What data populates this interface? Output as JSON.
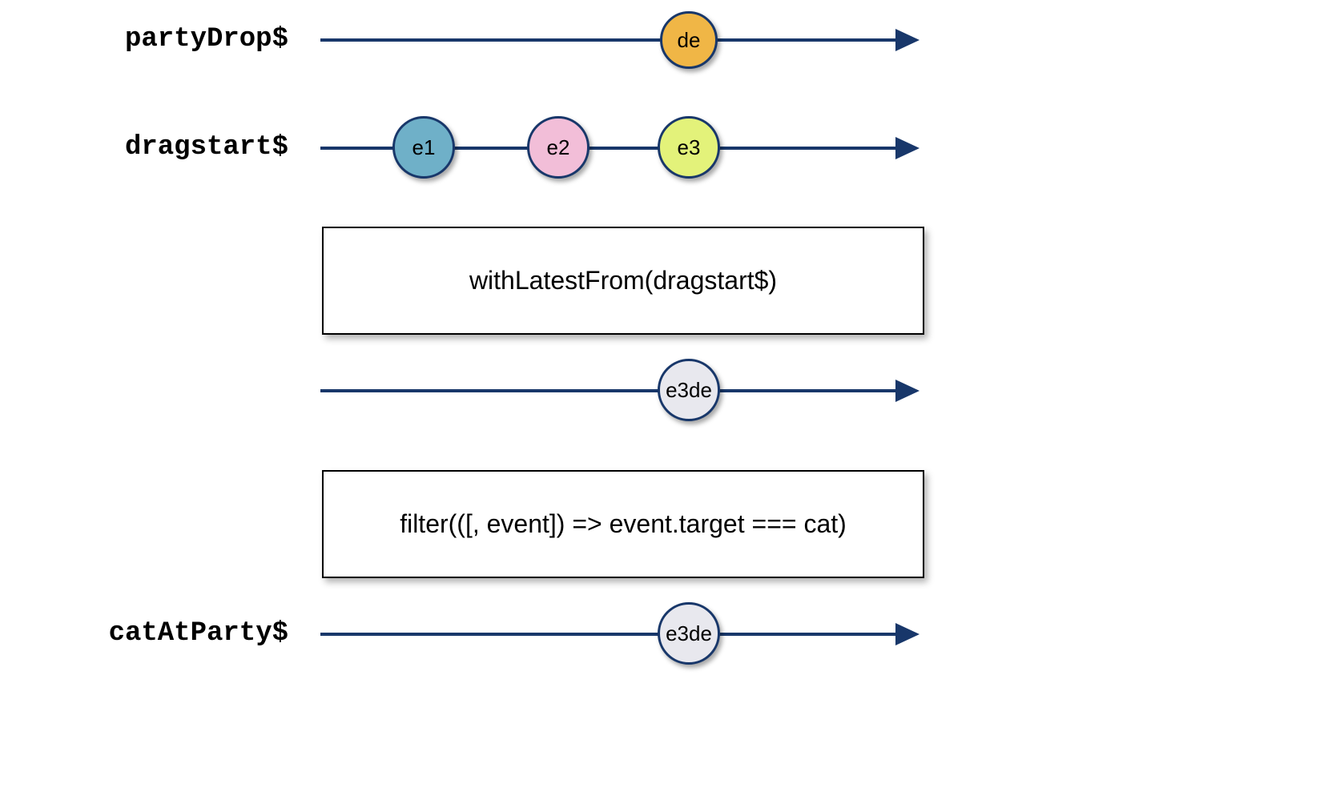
{
  "chart_data": {
    "type": "diagram",
    "streams": [
      {
        "name": "partyDrop$",
        "marbles": [
          {
            "label": "de",
            "position": 0.605,
            "color": "#f0b646"
          }
        ]
      },
      {
        "name": "dragstart$",
        "marbles": [
          {
            "label": "e1",
            "position": 0.175,
            "color": "#6fb0c8"
          },
          {
            "label": "e2",
            "position": 0.395,
            "color": "#f2bed8"
          },
          {
            "label": "e3",
            "position": 0.605,
            "color": "#e3f27a"
          }
        ]
      },
      {
        "name": "",
        "marbles": [
          {
            "label": "e3de",
            "position": 0.605,
            "color": "#e8e8ee"
          }
        ]
      },
      {
        "name": "catAtParty$",
        "marbles": [
          {
            "label": "e3de",
            "position": 0.605,
            "color": "#e8e8ee"
          }
        ]
      }
    ],
    "operators": [
      {
        "label": "withLatestFrom(dragstart$)"
      },
      {
        "label": "filter(([, event]) => event.target === cat)"
      }
    ]
  },
  "labels": {
    "stream0": "partyDrop$",
    "stream1": "dragstart$",
    "stream3": "catAtParty$"
  },
  "marbles": {
    "s0m0": "de",
    "s1m0": "e1",
    "s1m1": "e2",
    "s1m2": "e3",
    "s2m0": "e3de",
    "s3m0": "e3de"
  },
  "ops": {
    "op0": "withLatestFrom(dragstart$)",
    "op1": "filter(([, event]) => event.target === cat)"
  },
  "colors": {
    "line": "#18376a",
    "orange": "#f0b646",
    "blue": "#6fb0c8",
    "pink": "#f2bed8",
    "yellow": "#e3f27a",
    "grey": "#e8e8ee"
  }
}
